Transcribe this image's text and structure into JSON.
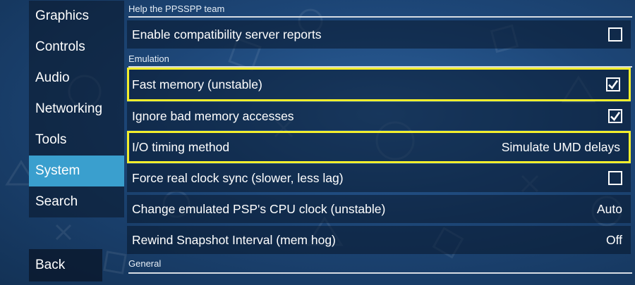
{
  "sidebar": {
    "items": [
      {
        "label": "Graphics",
        "selected": false
      },
      {
        "label": "Controls",
        "selected": false
      },
      {
        "label": "Audio",
        "selected": false
      },
      {
        "label": "Networking",
        "selected": false
      },
      {
        "label": "Tools",
        "selected": false
      },
      {
        "label": "System",
        "selected": true
      },
      {
        "label": "Search",
        "selected": false
      }
    ],
    "back_label": "Back"
  },
  "sections": {
    "help": "Help the PPSSPP team",
    "emulation": "Emulation",
    "general": "General"
  },
  "settings": {
    "compat_reports": {
      "label": "Enable compatibility server reports",
      "checked": false
    },
    "fast_memory": {
      "label": "Fast memory (unstable)",
      "checked": true
    },
    "ignore_bad_memory": {
      "label": "Ignore bad memory accesses",
      "checked": true
    },
    "io_timing": {
      "label": "I/O timing method",
      "value": "Simulate UMD delays"
    },
    "force_clock_sync": {
      "label": "Force real clock sync (slower, less lag)",
      "checked": false
    },
    "cpu_clock": {
      "label": "Change emulated PSP's CPU clock (unstable)",
      "value": "Auto"
    },
    "rewind_interval": {
      "label": "Rewind Snapshot Interval (mem hog)",
      "value": "Off"
    }
  },
  "colors": {
    "accent_selected": "#3a9fce",
    "highlight_border": "#f3ee2c",
    "background": "#1d4677"
  }
}
